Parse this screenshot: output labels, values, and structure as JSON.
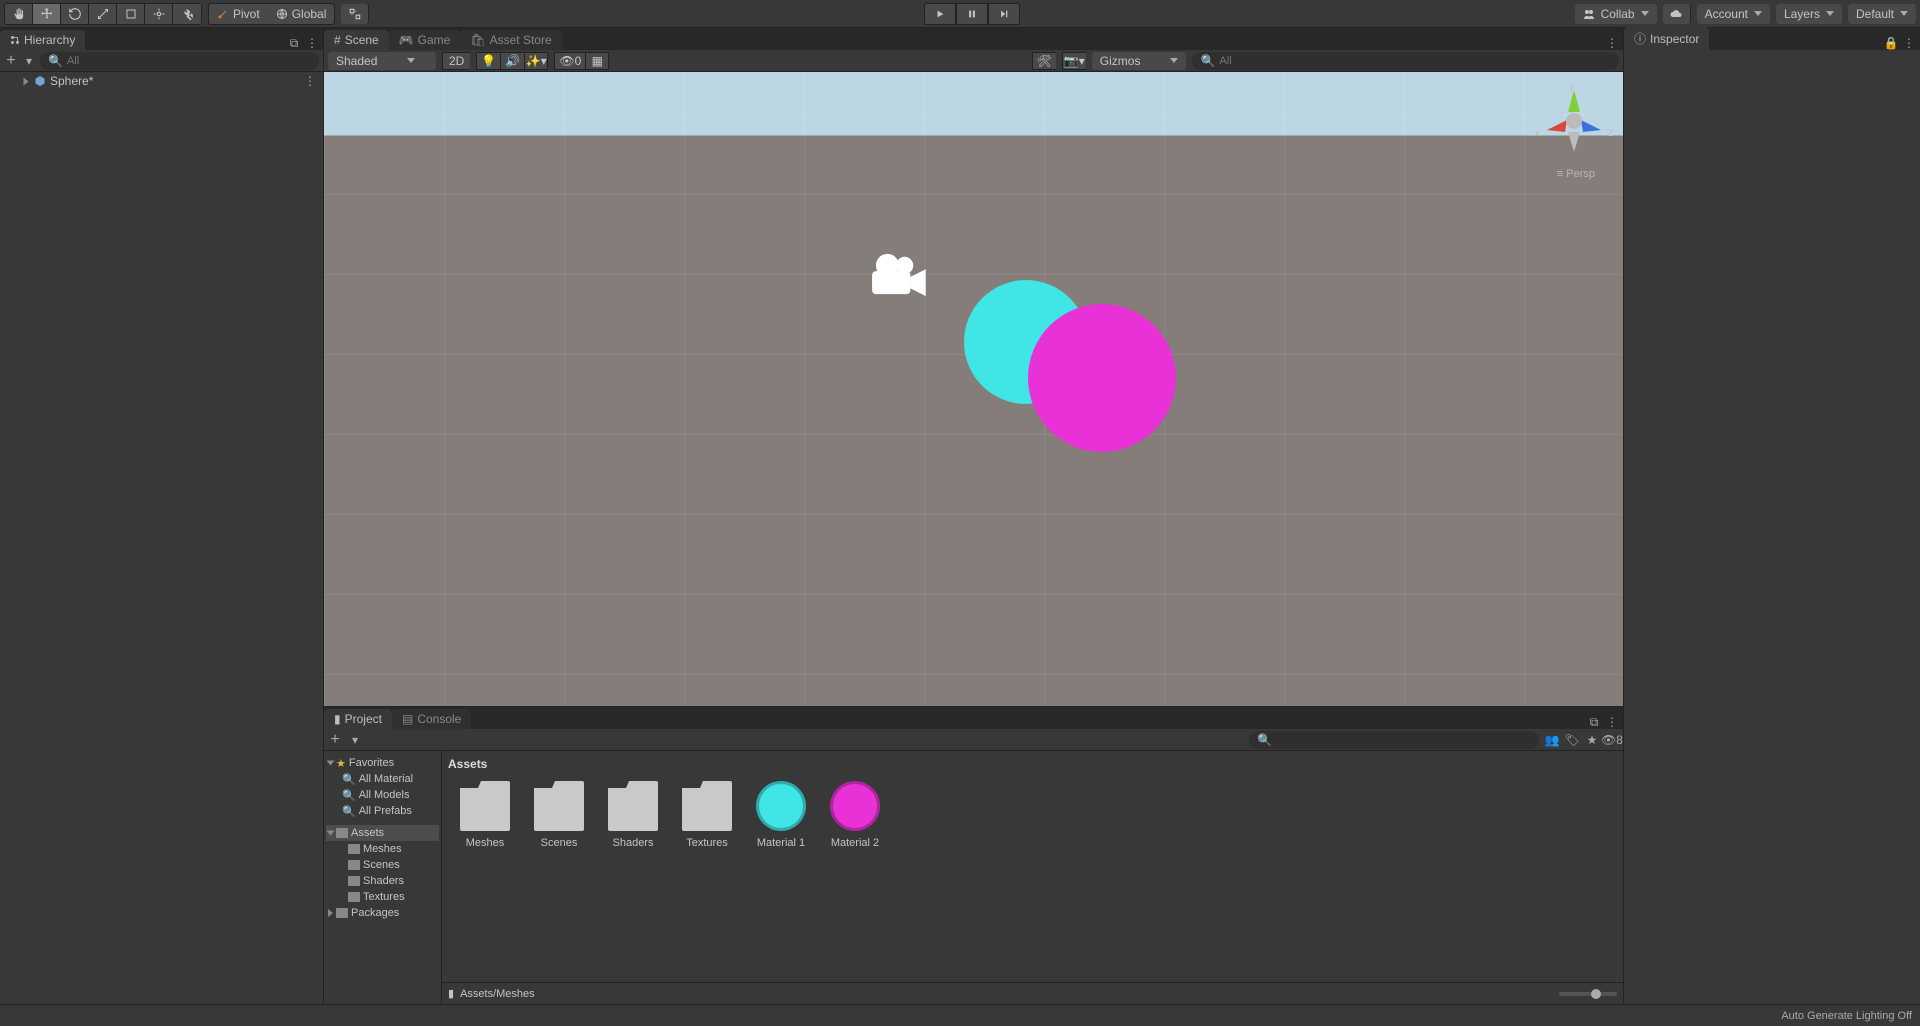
{
  "topbar": {
    "pivot_label": "Pivot",
    "global_label": "Global",
    "collab_label": "Collab",
    "account_label": "Account",
    "layers_label": "Layers",
    "layout_label": "Default"
  },
  "hierarchy": {
    "tab": "Hierarchy",
    "search_placeholder": "All",
    "items": [
      "Sphere*"
    ]
  },
  "scene": {
    "tabs": [
      "Scene",
      "Game",
      "Asset Store"
    ],
    "shading": "Shaded",
    "mode2d": "2D",
    "indicator_zero": "0",
    "gizmos_label": "Gizmos",
    "search_placeholder": "All",
    "axis_x": "x",
    "axis_y": "y",
    "axis_z": "z",
    "persp": "Persp"
  },
  "inspector": {
    "tab": "Inspector"
  },
  "project": {
    "tabs": [
      "Project",
      "Console"
    ],
    "hidden_count": "8",
    "breadcrumb": "Assets",
    "favorites_label": "Favorites",
    "favorites": [
      "All Material",
      "All Models",
      "All Prefabs"
    ],
    "assets_label": "Assets",
    "assets_children": [
      "Meshes",
      "Scenes",
      "Shaders",
      "Textures"
    ],
    "packages_label": "Packages",
    "grid": [
      {
        "name": "Meshes",
        "type": "folder"
      },
      {
        "name": "Scenes",
        "type": "folder"
      },
      {
        "name": "Shaders",
        "type": "folder"
      },
      {
        "name": "Textures",
        "type": "folder"
      },
      {
        "name": "Material 1",
        "type": "material",
        "color": "#40e5e5"
      },
      {
        "name": "Material 2",
        "type": "material",
        "color": "#e832d8"
      }
    ],
    "footer_path": "Assets/Meshes"
  },
  "status": {
    "text": "Auto Generate Lighting Off"
  }
}
